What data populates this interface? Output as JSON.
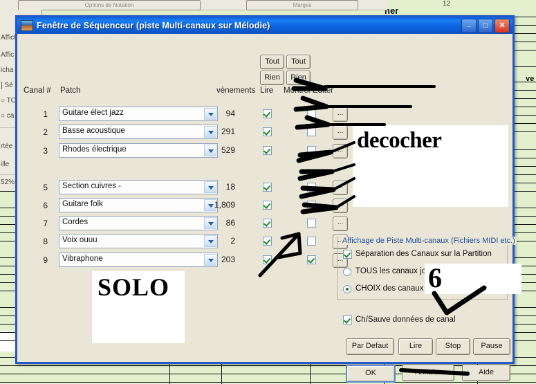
{
  "window": {
    "title": "Fenêtre de Séquenceur (piste Multi-canaux sur Mélodie)",
    "icon": "app-icon",
    "minimize_glyph": "_",
    "maximize_glyph": "□",
    "close_glyph": "✕"
  },
  "toolbar": {
    "tout_lire": "Tout",
    "tout_montrer": "Tout",
    "rien_lire": "Rien",
    "rien_montrer": "Rien"
  },
  "table": {
    "headers": {
      "canal": "Canal #",
      "patch": "Patch",
      "evenements": "vènements",
      "lire": "Lire",
      "montrer": "Montrer",
      "editer": "Editer"
    },
    "edit_button_label": "...",
    "rows": [
      {
        "num": "1",
        "patch": "Guitare élect jazz",
        "events": "94",
        "lire": true,
        "montrer": false
      },
      {
        "num": "2",
        "patch": "Basse acoustique",
        "events": "291",
        "lire": true,
        "montrer": false
      },
      {
        "num": "3",
        "patch": "Rhodes électrique",
        "events": "529",
        "lire": true,
        "montrer": false
      },
      {
        "num": "5",
        "patch": "Section cuivres -",
        "events": "18",
        "lire": true,
        "montrer": false
      },
      {
        "num": "6",
        "patch": "Guitare folk",
        "events": "1,809",
        "lire": true,
        "montrer": false
      },
      {
        "num": "7",
        "patch": "Cordes",
        "events": "86",
        "lire": true,
        "montrer": false
      },
      {
        "num": "8",
        "patch": "Voix ouuu",
        "events": "2",
        "lire": true,
        "montrer": false
      },
      {
        "num": "9",
        "patch": "Vibraphone",
        "events": "203",
        "lire": true,
        "montrer": true
      }
    ]
  },
  "group": {
    "title": "Affichage de Piste Multi-canaux (Fichiers MIDI etc.)",
    "checkbox_separation": "Séparation des Canaux sur la Partition",
    "radio_tous": "TOUS les canaux jouent/s'affichent",
    "radio_choix": "CHOIX des canaux à jouer",
    "checkbox_sauve": "Ch/Sauve données de canal"
  },
  "buttons": {
    "par_defaut": "Par Defaut",
    "lire": "Lire",
    "stop": "Stop",
    "pause": "Pause",
    "ok": "OK",
    "annuler": "Annuler",
    "aide": "Aide"
  },
  "annotations": {
    "decocher": "decocher",
    "solo": "SOLO",
    "six": "6"
  },
  "background": {
    "toolbar_buttons": [
      "Options de Notation",
      "Marges"
    ],
    "left_panel_lines": [
      "Affich",
      "Affic",
      "icha",
      "] Sé",
      "○ TO",
      "○ ca",
      "rtée",
      "ille",
      "52%"
    ],
    "measure_label": "ner",
    "number_12": "12",
    "ve_label": "ve"
  },
  "colors": {
    "dialog_face": "#eae6d7",
    "title_blue": "#0a63dd",
    "border_blue": "#2359c8",
    "group_title": "#1f4e9c",
    "check_green": "#1b8a1b",
    "score_green": "#e2f0cd"
  }
}
